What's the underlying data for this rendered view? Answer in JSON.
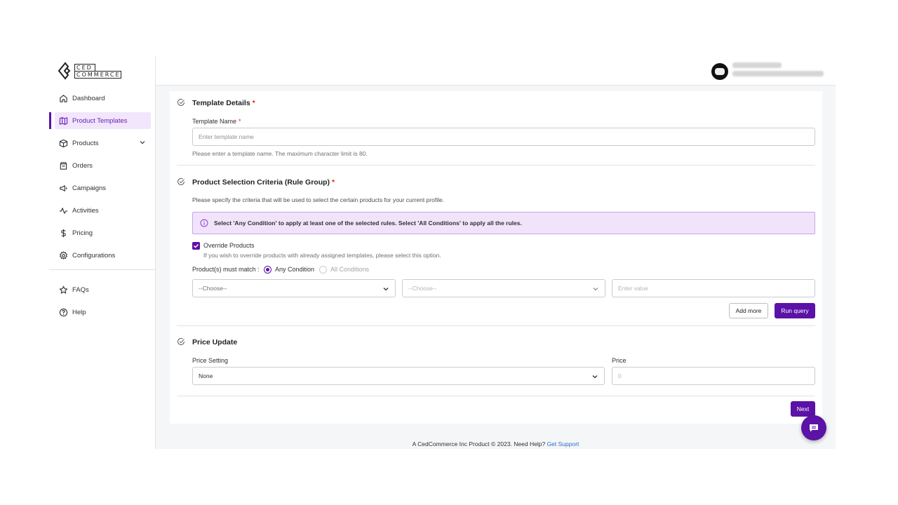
{
  "brand": {
    "line1": "CED",
    "line2": "COMMERCE"
  },
  "sidebar": {
    "items": [
      {
        "label": "Dashboard",
        "icon": "home-icon"
      },
      {
        "label": "Product Templates",
        "icon": "map-icon",
        "active": true
      },
      {
        "label": "Products",
        "icon": "box-icon",
        "expandable": true
      },
      {
        "label": "Orders",
        "icon": "bag-icon"
      },
      {
        "label": "Campaigns",
        "icon": "megaphone-icon"
      },
      {
        "label": "Activities",
        "icon": "activity-icon"
      },
      {
        "label": "Pricing",
        "icon": "dollar-icon"
      },
      {
        "label": "Configurations",
        "icon": "gear-icon"
      }
    ],
    "bottom_items": [
      {
        "label": "FAQs",
        "icon": "star-icon"
      },
      {
        "label": "Help",
        "icon": "help-circle-icon"
      }
    ]
  },
  "template_details": {
    "title": "Template Details",
    "required_mark": "*",
    "name_label": "Template Name",
    "name_placeholder": "Enter template name",
    "name_help": "Please enter a template name. The maximum character limit is 80."
  },
  "product_selection": {
    "title": "Product Selection Criteria (Rule Group)",
    "required_mark": "*",
    "description": "Please specify the criteria that will be used to select the certain products for your current profile.",
    "banner": "Select 'Any Condition' to apply at least one of the selected rules. Select 'All Conditions' to apply all the rules.",
    "override_label": "Override Products",
    "override_checked": true,
    "override_help": "If you wish to override products with already assigned templates, please select this option.",
    "match_label": "Product(s) must match :",
    "match_options": [
      "Any Condition",
      "All Conditions"
    ],
    "match_selected": "Any Condition",
    "rule_field_1": "--Choose--",
    "rule_field_2": "--Choose--",
    "rule_value_placeholder": "Enter value",
    "add_more": "Add more",
    "run_query": "Run query"
  },
  "price_update": {
    "title": "Price Update",
    "setting_label": "Price Setting",
    "setting_value": "None",
    "price_label": "Price",
    "price_placeholder": "0"
  },
  "actions": {
    "next": "Next"
  },
  "footer": {
    "text": "A CedCommerce Inc Product © 2023. Need Help?",
    "link": "Get Support"
  },
  "colors": {
    "accent": "#5b12a6",
    "active_bg": "#f1e6fb",
    "banner_bg": "#f1e4fa",
    "required": "#d72c0d",
    "link": "#2c6ecb"
  }
}
